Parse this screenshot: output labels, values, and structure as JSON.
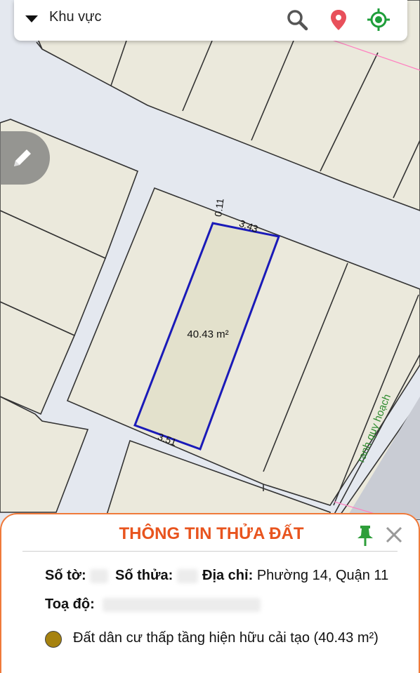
{
  "topbar": {
    "region_label": "Khu vực",
    "icons": [
      "search-icon",
      "location-pin-icon",
      "my-location-icon"
    ],
    "colors": {
      "search": "#555555",
      "pin": "#e8505b",
      "locate": "#1e9e3a"
    }
  },
  "map": {
    "area_label": "40.43 m²",
    "dimension_labels": [
      "0.11",
      "3.43",
      "3.51"
    ],
    "planning_line_label": "ranh quy hoạch",
    "colors": {
      "parcel_outline": "#1a1ab8",
      "parcel_fill": "#e3e1cc",
      "road": "#e4e8ef",
      "lot": "#ebe9dc",
      "planning_text": "#2e8b2e",
      "planning_line": "#ff80c0"
    }
  },
  "edit_button": {
    "icon": "pencil-icon"
  },
  "panel": {
    "title": "THÔNG TIN THỬA ĐẤT",
    "so_to_label": "Số tờ:",
    "so_thua_label": "Số thửa:",
    "dia_chi_label": "Địa chỉ:",
    "dia_chi_value": "Phường 14, Quận 11",
    "toa_do_label": "Toạ độ:",
    "land_use": "Đất dân cư thấp tầng hiện hữu cải tạo (40.43 m²)",
    "land_use_color": "#a6820f",
    "accent": "#e8541e"
  }
}
